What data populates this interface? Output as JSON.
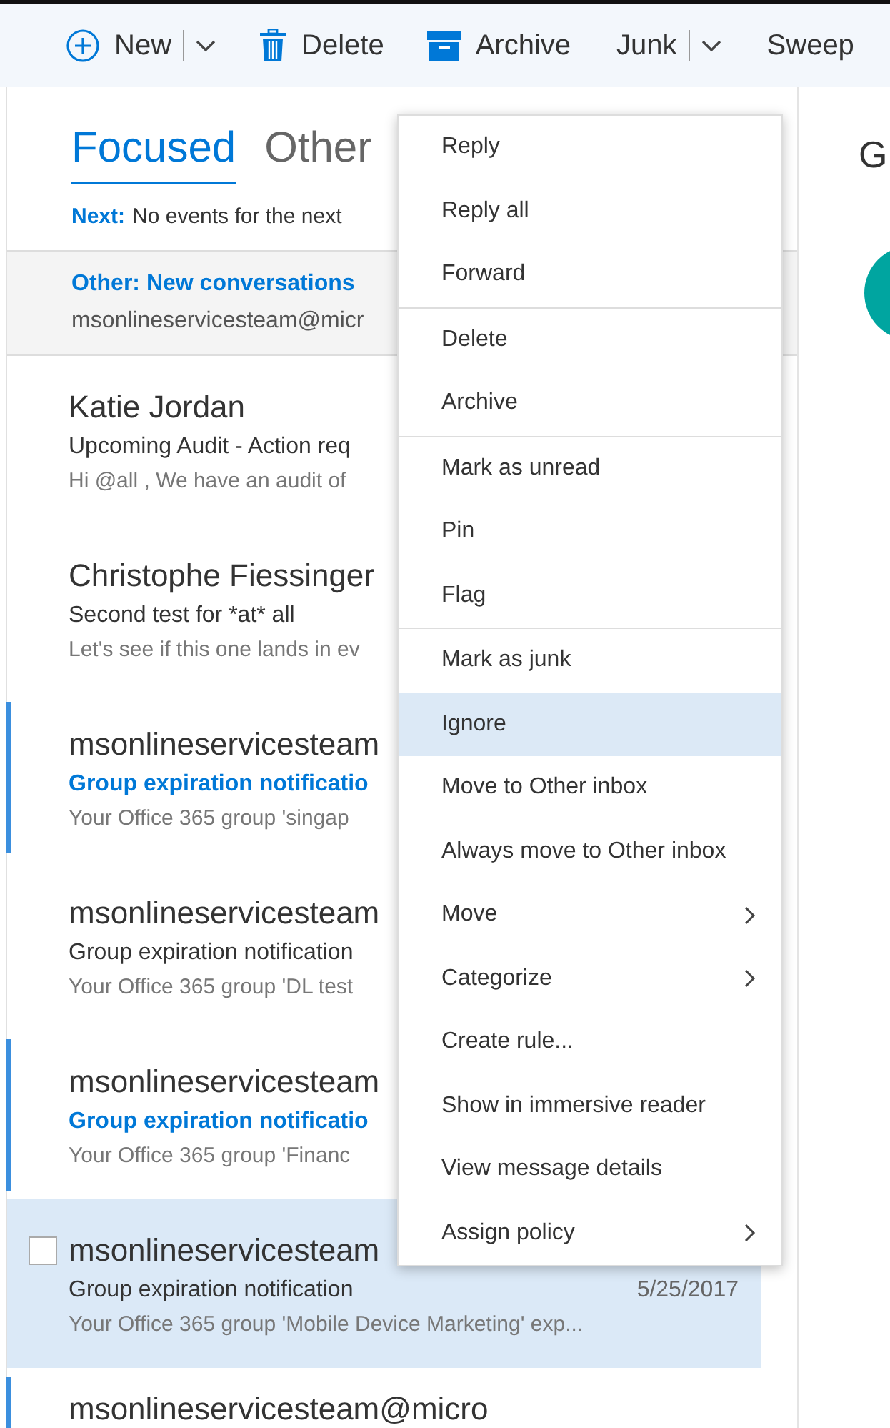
{
  "toolbar": {
    "new": {
      "label": "New",
      "dropdown": true
    },
    "delete": {
      "label": "Delete"
    },
    "archive": {
      "label": "Archive"
    },
    "junk": {
      "label": "Junk",
      "dropdown": true
    },
    "sweep": {
      "label": "Sweep"
    }
  },
  "pivots": [
    {
      "label": "Focused",
      "selected": true
    },
    {
      "label": "Other",
      "selected": false
    }
  ],
  "next": {
    "label": "Next:",
    "text": "No events for the next"
  },
  "other_banner": {
    "title": "Other: New conversations",
    "senders": "msonlineservicesteam@micr"
  },
  "messages": [
    {
      "sender": "Katie Jordan",
      "subject": "Upcoming Audit - Action req",
      "preview": "Hi @all ,  We have an audit of",
      "unread": false,
      "selected": false
    },
    {
      "sender": "Christophe Fiessinger",
      "subject": "Second test for *at* all",
      "preview": "Let's see if this one lands in ev",
      "unread": false,
      "selected": false
    },
    {
      "sender": "msonlineservicesteam",
      "subject": "Group expiration notificatio",
      "preview": "Your Office 365 group 'singap",
      "unread": true,
      "selected": false
    },
    {
      "sender": "msonlineservicesteam",
      "subject": "Group expiration notification",
      "preview": "Your Office 365 group 'DL test",
      "unread": false,
      "selected": false
    },
    {
      "sender": "msonlineservicesteam",
      "subject": "Group expiration notificatio",
      "preview": "Your Office 365 group 'Financ",
      "unread": true,
      "selected": false
    },
    {
      "sender": "msonlineservicesteam",
      "subject": "Group expiration notification",
      "date": "5/25/2017",
      "preview": "Your Office 365 group 'Mobile Device Marketing' exp...",
      "unread": false,
      "selected": true
    },
    {
      "sender": "msonlineservicesteam@micro",
      "unread": true,
      "selected": false
    }
  ],
  "reading_pane": {
    "title": "G"
  },
  "context_menu": {
    "groups": [
      [
        {
          "label": "Reply",
          "selected": false,
          "submenu": false
        },
        {
          "label": "Reply all",
          "selected": false,
          "submenu": false
        },
        {
          "label": "Forward",
          "selected": false,
          "submenu": false
        }
      ],
      [
        {
          "label": "Delete",
          "selected": false,
          "submenu": false
        },
        {
          "label": "Archive",
          "selected": false,
          "submenu": false
        }
      ],
      [
        {
          "label": "Mark as unread",
          "selected": false,
          "submenu": false
        },
        {
          "label": "Pin",
          "selected": false,
          "submenu": false
        },
        {
          "label": "Flag",
          "selected": false,
          "submenu": false
        }
      ],
      [
        {
          "label": "Mark as junk",
          "selected": false,
          "submenu": false
        },
        {
          "label": "Ignore",
          "selected": true,
          "submenu": false
        },
        {
          "label": "Move to Other inbox",
          "selected": false,
          "submenu": false
        },
        {
          "label": "Always move to Other inbox",
          "selected": false,
          "submenu": false
        },
        {
          "label": "Move",
          "selected": false,
          "submenu": true
        },
        {
          "label": "Categorize",
          "selected": false,
          "submenu": true
        },
        {
          "label": "Create rule...",
          "selected": false,
          "submenu": false
        },
        {
          "label": "Show in immersive reader",
          "selected": false,
          "submenu": false
        },
        {
          "label": "View message details",
          "selected": false,
          "submenu": false
        },
        {
          "label": "Assign policy",
          "selected": false,
          "submenu": true
        }
      ]
    ]
  }
}
